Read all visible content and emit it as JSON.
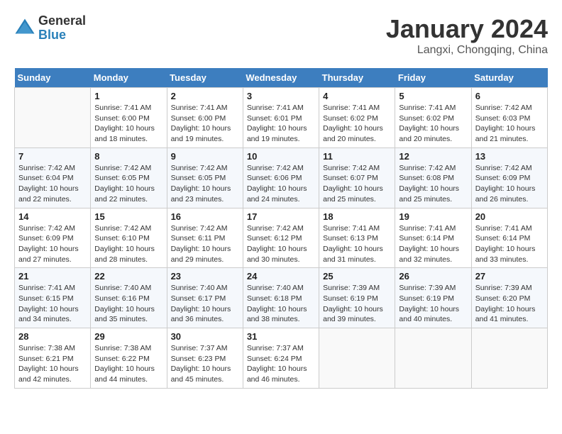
{
  "logo": {
    "general": "General",
    "blue": "Blue"
  },
  "title": "January 2024",
  "subtitle": "Langxi, Chongqing, China",
  "days_of_week": [
    "Sunday",
    "Monday",
    "Tuesday",
    "Wednesday",
    "Thursday",
    "Friday",
    "Saturday"
  ],
  "weeks": [
    [
      {
        "day": "",
        "content": ""
      },
      {
        "day": "1",
        "content": "Sunrise: 7:41 AM\nSunset: 6:00 PM\nDaylight: 10 hours\nand 18 minutes."
      },
      {
        "day": "2",
        "content": "Sunrise: 7:41 AM\nSunset: 6:00 PM\nDaylight: 10 hours\nand 19 minutes."
      },
      {
        "day": "3",
        "content": "Sunrise: 7:41 AM\nSunset: 6:01 PM\nDaylight: 10 hours\nand 19 minutes."
      },
      {
        "day": "4",
        "content": "Sunrise: 7:41 AM\nSunset: 6:02 PM\nDaylight: 10 hours\nand 20 minutes."
      },
      {
        "day": "5",
        "content": "Sunrise: 7:41 AM\nSunset: 6:02 PM\nDaylight: 10 hours\nand 20 minutes."
      },
      {
        "day": "6",
        "content": "Sunrise: 7:42 AM\nSunset: 6:03 PM\nDaylight: 10 hours\nand 21 minutes."
      }
    ],
    [
      {
        "day": "7",
        "content": "Sunrise: 7:42 AM\nSunset: 6:04 PM\nDaylight: 10 hours\nand 22 minutes."
      },
      {
        "day": "8",
        "content": "Sunrise: 7:42 AM\nSunset: 6:05 PM\nDaylight: 10 hours\nand 22 minutes."
      },
      {
        "day": "9",
        "content": "Sunrise: 7:42 AM\nSunset: 6:05 PM\nDaylight: 10 hours\nand 23 minutes."
      },
      {
        "day": "10",
        "content": "Sunrise: 7:42 AM\nSunset: 6:06 PM\nDaylight: 10 hours\nand 24 minutes."
      },
      {
        "day": "11",
        "content": "Sunrise: 7:42 AM\nSunset: 6:07 PM\nDaylight: 10 hours\nand 25 minutes."
      },
      {
        "day": "12",
        "content": "Sunrise: 7:42 AM\nSunset: 6:08 PM\nDaylight: 10 hours\nand 25 minutes."
      },
      {
        "day": "13",
        "content": "Sunrise: 7:42 AM\nSunset: 6:09 PM\nDaylight: 10 hours\nand 26 minutes."
      }
    ],
    [
      {
        "day": "14",
        "content": "Sunrise: 7:42 AM\nSunset: 6:09 PM\nDaylight: 10 hours\nand 27 minutes."
      },
      {
        "day": "15",
        "content": "Sunrise: 7:42 AM\nSunset: 6:10 PM\nDaylight: 10 hours\nand 28 minutes."
      },
      {
        "day": "16",
        "content": "Sunrise: 7:42 AM\nSunset: 6:11 PM\nDaylight: 10 hours\nand 29 minutes."
      },
      {
        "day": "17",
        "content": "Sunrise: 7:42 AM\nSunset: 6:12 PM\nDaylight: 10 hours\nand 30 minutes."
      },
      {
        "day": "18",
        "content": "Sunrise: 7:41 AM\nSunset: 6:13 PM\nDaylight: 10 hours\nand 31 minutes."
      },
      {
        "day": "19",
        "content": "Sunrise: 7:41 AM\nSunset: 6:14 PM\nDaylight: 10 hours\nand 32 minutes."
      },
      {
        "day": "20",
        "content": "Sunrise: 7:41 AM\nSunset: 6:14 PM\nDaylight: 10 hours\nand 33 minutes."
      }
    ],
    [
      {
        "day": "21",
        "content": "Sunrise: 7:41 AM\nSunset: 6:15 PM\nDaylight: 10 hours\nand 34 minutes."
      },
      {
        "day": "22",
        "content": "Sunrise: 7:40 AM\nSunset: 6:16 PM\nDaylight: 10 hours\nand 35 minutes."
      },
      {
        "day": "23",
        "content": "Sunrise: 7:40 AM\nSunset: 6:17 PM\nDaylight: 10 hours\nand 36 minutes."
      },
      {
        "day": "24",
        "content": "Sunrise: 7:40 AM\nSunset: 6:18 PM\nDaylight: 10 hours\nand 38 minutes."
      },
      {
        "day": "25",
        "content": "Sunrise: 7:39 AM\nSunset: 6:19 PM\nDaylight: 10 hours\nand 39 minutes."
      },
      {
        "day": "26",
        "content": "Sunrise: 7:39 AM\nSunset: 6:19 PM\nDaylight: 10 hours\nand 40 minutes."
      },
      {
        "day": "27",
        "content": "Sunrise: 7:39 AM\nSunset: 6:20 PM\nDaylight: 10 hours\nand 41 minutes."
      }
    ],
    [
      {
        "day": "28",
        "content": "Sunrise: 7:38 AM\nSunset: 6:21 PM\nDaylight: 10 hours\nand 42 minutes."
      },
      {
        "day": "29",
        "content": "Sunrise: 7:38 AM\nSunset: 6:22 PM\nDaylight: 10 hours\nand 44 minutes."
      },
      {
        "day": "30",
        "content": "Sunrise: 7:37 AM\nSunset: 6:23 PM\nDaylight: 10 hours\nand 45 minutes."
      },
      {
        "day": "31",
        "content": "Sunrise: 7:37 AM\nSunset: 6:24 PM\nDaylight: 10 hours\nand 46 minutes."
      },
      {
        "day": "",
        "content": ""
      },
      {
        "day": "",
        "content": ""
      },
      {
        "day": "",
        "content": ""
      }
    ]
  ]
}
